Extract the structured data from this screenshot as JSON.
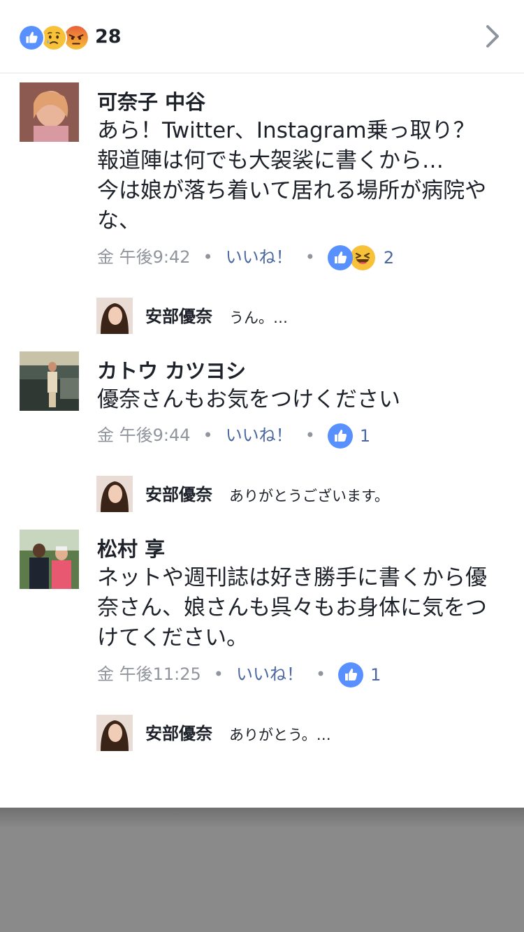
{
  "header": {
    "reaction_icons": [
      "like-icon",
      "sad-icon",
      "angry-icon"
    ],
    "reaction_count": "28",
    "accent": "#5890ff"
  },
  "comments": [
    {
      "author": "可奈子 中谷",
      "lines": [
        "あら！Twitter、Instagram乗っ取り？",
        "報道陣は何でも大袈裟に書くから…",
        "今は娘が落ち着いて居れる場所が病院や",
        "な、"
      ],
      "time": "金 午後9:42",
      "like_label": "いいね！",
      "reactions": [
        "like-icon",
        "haha-icon"
      ],
      "reaction_count": "2",
      "reply": {
        "author": "安部優奈",
        "text": "うん。…"
      }
    },
    {
      "author": "カトウ カツヨシ",
      "lines": [
        "優奈さんもお気をつけください"
      ],
      "time": "金 午後9:44",
      "like_label": "いいね！",
      "reactions": [
        "like-icon"
      ],
      "reaction_count": "1",
      "reply": {
        "author": "安部優奈",
        "text": "ありがとうございます。"
      }
    },
    {
      "author": "松村 享",
      "lines": [
        "ネットや週刊誌は好き勝手に書くから優",
        "奈さん、娘さんも呉々もお身体に気をつ",
        "けてください。"
      ],
      "time": "金 午後11:25",
      "like_label": "いいね！",
      "reactions": [
        "like-icon"
      ],
      "reaction_count": "1",
      "reply": {
        "author": "安部優奈",
        "text": "ありがとう。…"
      }
    }
  ]
}
